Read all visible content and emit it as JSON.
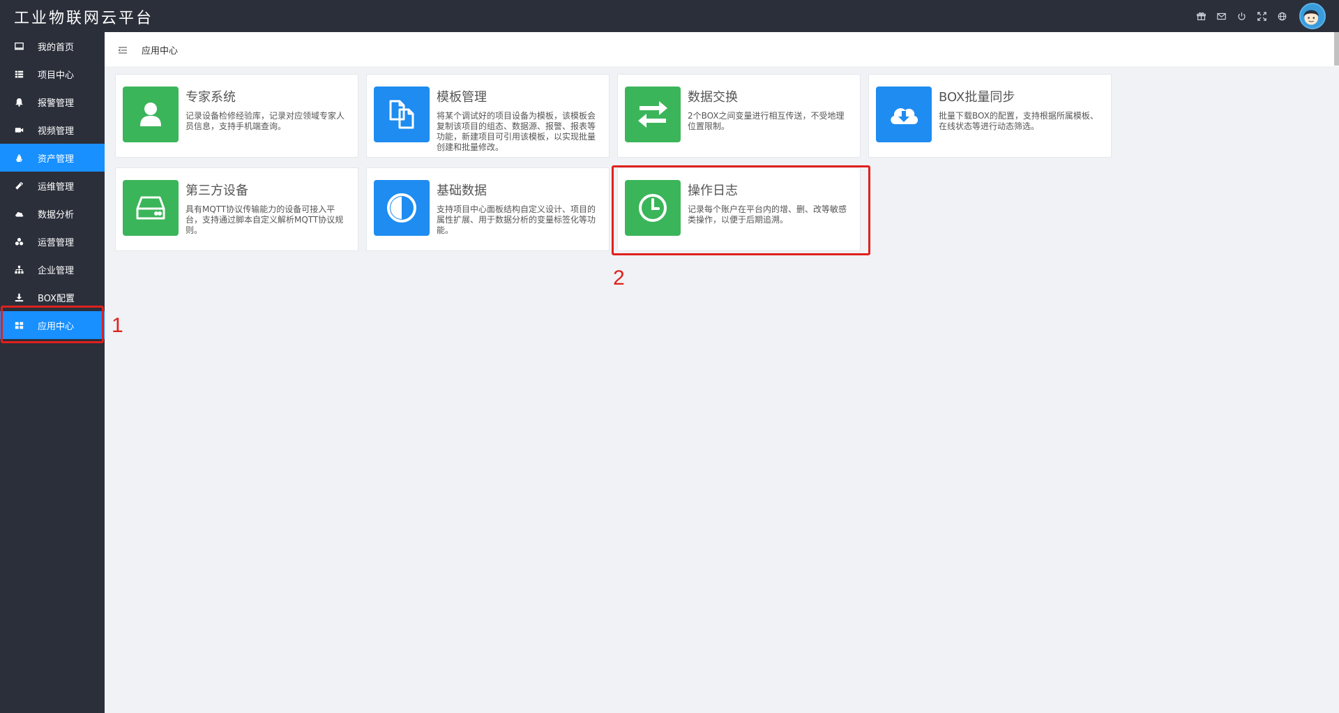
{
  "app": {
    "title": "工业物联网云平台"
  },
  "topbar": {
    "icons": [
      "gift-icon",
      "mail-icon",
      "power-icon",
      "fullscreen-icon",
      "globe-icon"
    ]
  },
  "sidebar": {
    "items": [
      {
        "label": "我的首页",
        "icon": "monitor-icon",
        "active": false
      },
      {
        "label": "项目中心",
        "icon": "list-icon",
        "active": false
      },
      {
        "label": "报警管理",
        "icon": "bell-icon",
        "active": false
      },
      {
        "label": "视频管理",
        "icon": "video-icon",
        "active": false
      },
      {
        "label": "资产管理",
        "icon": "recycle-icon",
        "active": true
      },
      {
        "label": "运维管理",
        "icon": "wrench-icon",
        "active": false
      },
      {
        "label": "数据分析",
        "icon": "cloud-icon",
        "active": false
      },
      {
        "label": "运营管理",
        "icon": "cubes-icon",
        "active": false
      },
      {
        "label": "企业管理",
        "icon": "sitemap-icon",
        "active": false
      },
      {
        "label": "BOX配置",
        "icon": "download-icon",
        "active": false
      },
      {
        "label": "应用中心",
        "icon": "grid-icon",
        "active": true
      }
    ]
  },
  "breadcrumb": {
    "text": "应用中心"
  },
  "cards": [
    {
      "title": "专家系统",
      "desc": "记录设备检修经验库，记录对应领域专家人员信息，支持手机端查询。",
      "icon": "user-icon",
      "color": "#3bb55a"
    },
    {
      "title": "模板管理",
      "desc": "将某个调试好的项目设备为模板，该模板会复制该项目的组态、数据源、报警、报表等功能，新建项目可引用该模板，以实现批量创建和批量修改。",
      "icon": "copy-icon",
      "color": "#1e8cf0"
    },
    {
      "title": "数据交换",
      "desc": "2个BOX之间变量进行相互传送，不受地理位置限制。",
      "icon": "exchange-icon",
      "color": "#3bb55a"
    },
    {
      "title": "BOX批量同步",
      "desc": "批量下载BOX的配置，支持根据所属模板、在线状态等进行动态筛选。",
      "icon": "cloud-download-icon",
      "color": "#1e8cf0"
    },
    {
      "title": "第三方设备",
      "desc": "具有MQTT协议传输能力的设备可接入平台，支持通过脚本自定义解析MQTT协议规则。",
      "icon": "hdd-icon",
      "color": "#3bb55a"
    },
    {
      "title": "基础数据",
      "desc": "支持项目中心面板结构自定义设计、项目的属性扩展、用于数据分析的变量标签化等功能。",
      "icon": "contrast-icon",
      "color": "#1e8cf0"
    },
    {
      "title": "操作日志",
      "desc": "记录每个账户在平台内的增、删、改等敏感类操作，以便于后期追溯。",
      "icon": "clock-icon",
      "color": "#3bb55a"
    }
  ],
  "annotations": {
    "label_1": "1",
    "label_2": "2",
    "color": "#e0201d"
  }
}
